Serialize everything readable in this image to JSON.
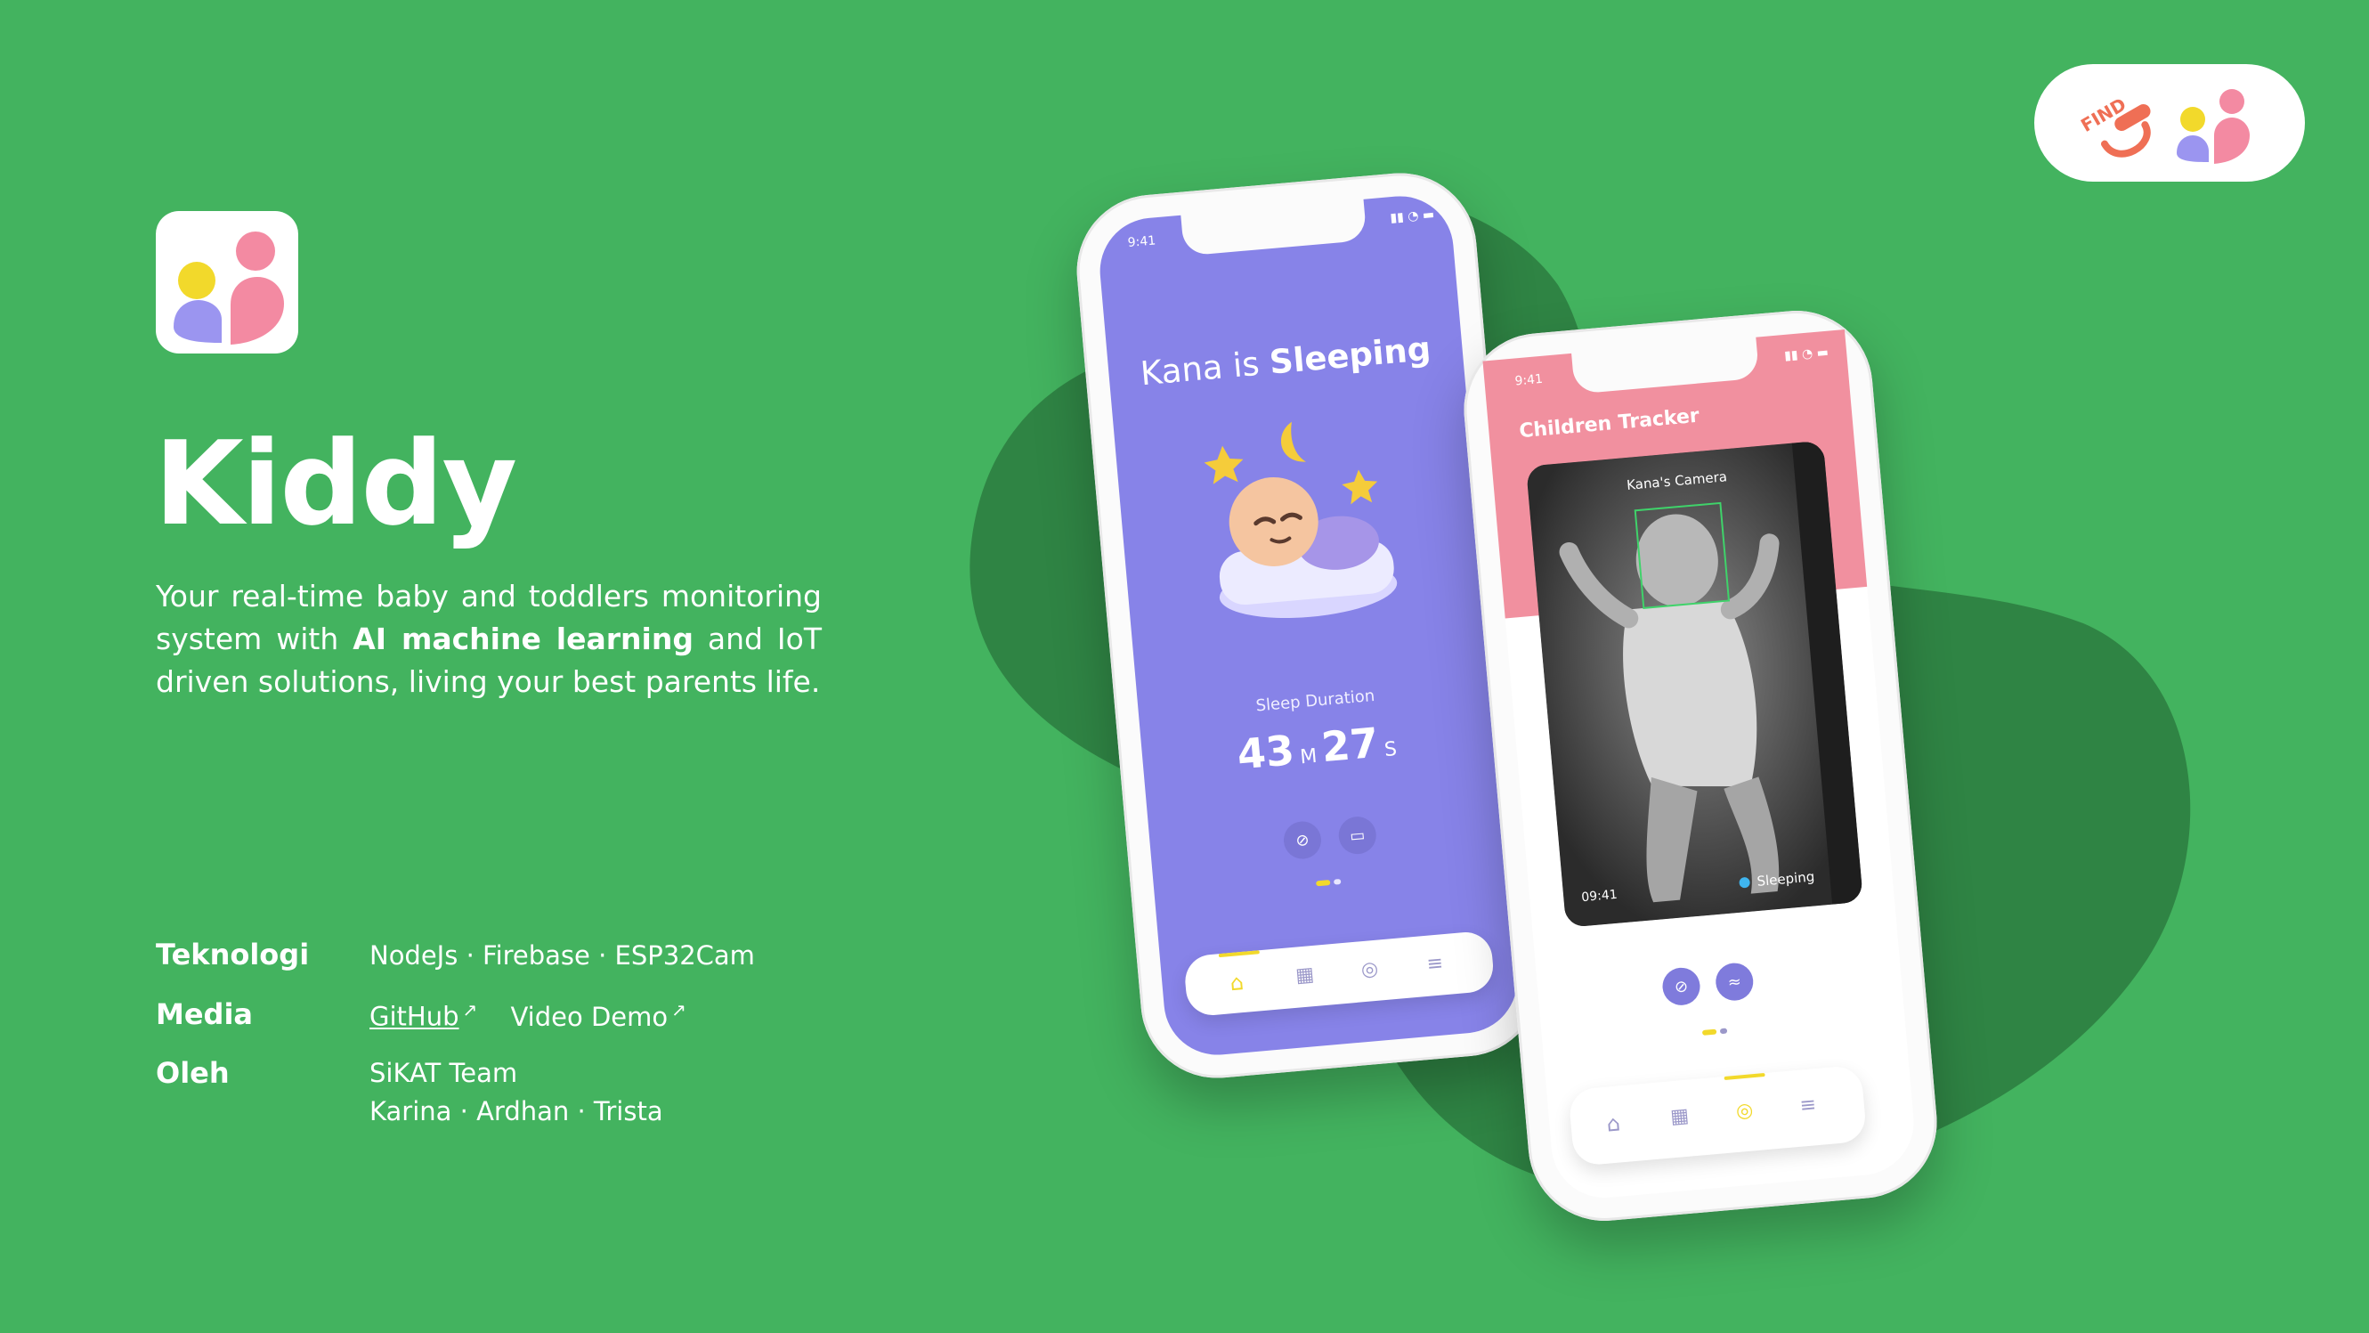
{
  "brand": {
    "name": "Kiddy",
    "description_part1": "Your real-time baby and toddlers monitoring system with ",
    "description_bold": "AI machine learning",
    "description_part2": " and IoT driven solutions, living your best parents life.",
    "colors": {
      "background": "#43b35f",
      "accent_purple": "#8783e8",
      "accent_pink": "#f1909f",
      "accent_yellow": "#f2d92b"
    }
  },
  "badge": {
    "text": "FIND"
  },
  "info": {
    "tech_label": "Teknologi",
    "tech_value": "NodeJs · Firebase · ESP32Cam",
    "media_label": "Media",
    "media_github": "GitHub",
    "media_demo": "Video Demo",
    "by_label": "Oleh",
    "by_team": "SiKAT Team",
    "by_members": "Karina · Ardhan · Trista"
  },
  "phone1": {
    "time": "9:41",
    "title_prefix": "Kana is ",
    "title_bold": "Sleeping",
    "duration_label": "Sleep Duration",
    "minutes": "43",
    "minutes_unit": "M",
    "seconds": "27",
    "seconds_unit": "S",
    "nav_icons": [
      "home-icon",
      "grid-icon",
      "compass-icon",
      "sliders-icon"
    ]
  },
  "phone2": {
    "time": "9:41",
    "header": "Children Tracker",
    "camera_label": "Kana's Camera",
    "cam_time": "09:41",
    "status": "Sleeping",
    "nav_icons": [
      "home-icon",
      "grid-icon",
      "compass-icon",
      "sliders-icon"
    ]
  }
}
